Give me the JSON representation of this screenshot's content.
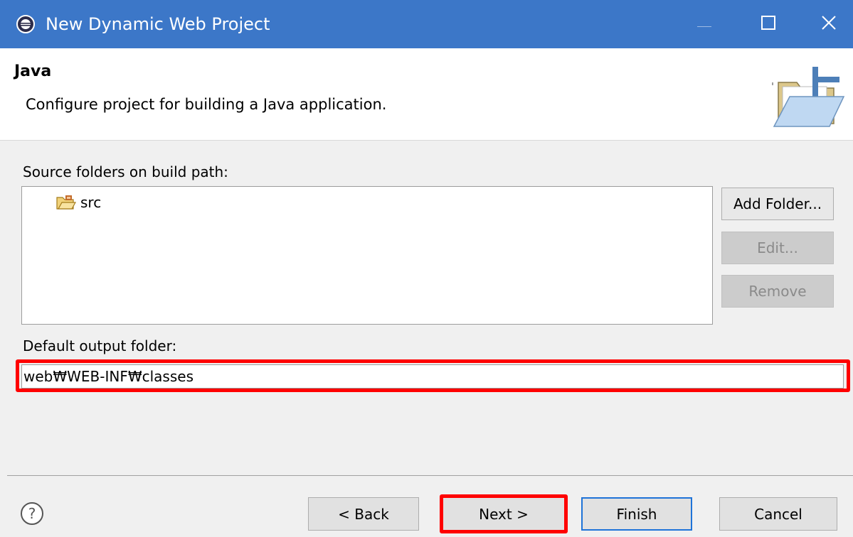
{
  "window": {
    "title": "New Dynamic Web Project",
    "title_bar_color": "#3c77c8",
    "controls": [
      "minimize-icon",
      "maximize-icon",
      "close-icon"
    ]
  },
  "banner": {
    "heading": "Java",
    "description": "Configure project for building a Java application.",
    "icon": "folder-icon"
  },
  "source": {
    "label": "Source folders on build path:",
    "items": [
      {
        "name": "src",
        "icon": "package-folder-icon"
      }
    ],
    "buttons": {
      "add": "Add Folder...",
      "edit": "Edit...",
      "remove": "Remove"
    }
  },
  "output": {
    "label": "Default output folder:",
    "value": "web₩WEB-INF₩classes"
  },
  "footer": {
    "help_icon": "help-icon",
    "back": "< Back",
    "next": "Next >",
    "finish": "Finish",
    "cancel": "Cancel"
  },
  "highlights": {
    "color": "#ff0000",
    "targets": [
      "output-folder-field",
      "next-button"
    ]
  }
}
